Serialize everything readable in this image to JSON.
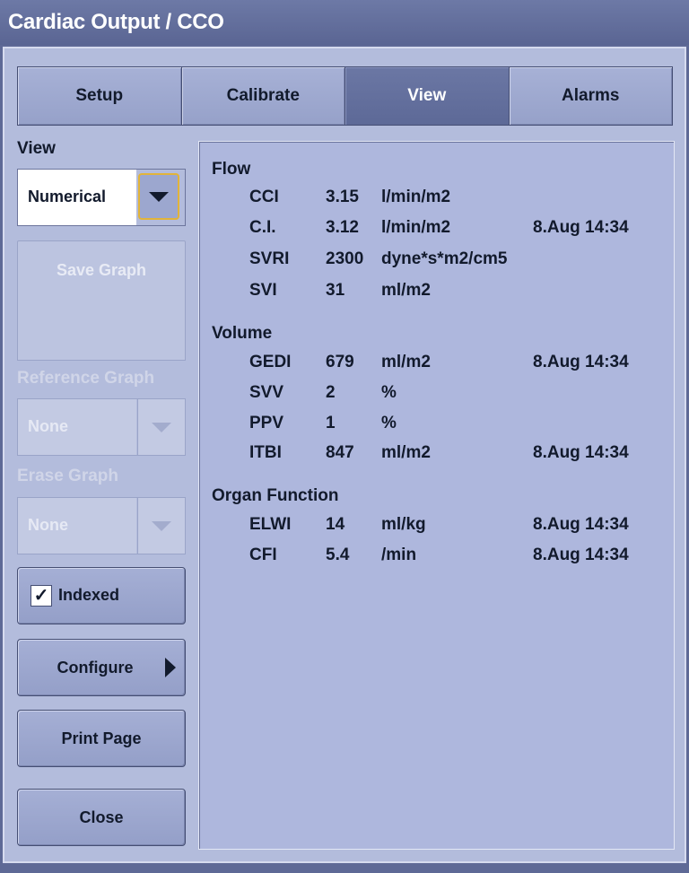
{
  "window": {
    "title": "Cardiac Output / CCO"
  },
  "tabs": [
    {
      "label": "Setup",
      "active": false
    },
    {
      "label": "Calibrate",
      "active": false
    },
    {
      "label": "View",
      "active": true
    },
    {
      "label": "Alarms",
      "active": false
    }
  ],
  "sidebar": {
    "view_label": "View",
    "view_value": "Numerical",
    "save_graph_label": "Save Graph",
    "reference_graph_label": "Reference Graph",
    "reference_graph_value": "None",
    "erase_graph_label": "Erase Graph",
    "erase_graph_value": "None",
    "indexed_label": "Indexed",
    "indexed_checked": "✓",
    "configure_label": "Configure",
    "print_page_label": "Print Page",
    "close_label": "Close"
  },
  "panel": {
    "sections": [
      {
        "title": "Flow",
        "rows": [
          {
            "name": "CCI",
            "value": "3.15",
            "unit": "l/min/m2",
            "time": ""
          },
          {
            "name": "C.I.",
            "value": "3.12",
            "unit": "l/min/m2",
            "time": "8.Aug 14:34"
          },
          {
            "name": "SVRI",
            "value": "2300",
            "unit": "dyne*s*m2/cm5",
            "time": ""
          },
          {
            "name": "SVI",
            "value": "31",
            "unit": "ml/m2",
            "time": ""
          }
        ]
      },
      {
        "title": "Volume",
        "rows": [
          {
            "name": "GEDI",
            "value": "679",
            "unit": "ml/m2",
            "time": "8.Aug 14:34"
          },
          {
            "name": "SVV",
            "value": "2",
            "unit": "%",
            "time": ""
          },
          {
            "name": "PPV",
            "value": "1",
            "unit": "%",
            "time": ""
          },
          {
            "name": "ITBI",
            "value": "847",
            "unit": "ml/m2",
            "time": "8.Aug 14:34"
          }
        ]
      },
      {
        "title": "Organ Function",
        "rows": [
          {
            "name": "ELWI",
            "value": "14",
            "unit": "ml/kg",
            "time": "8.Aug 14:34"
          },
          {
            "name": "CFI",
            "value": "5.4",
            "unit": "/min",
            "time": "8.Aug 14:34"
          }
        ]
      }
    ]
  }
}
